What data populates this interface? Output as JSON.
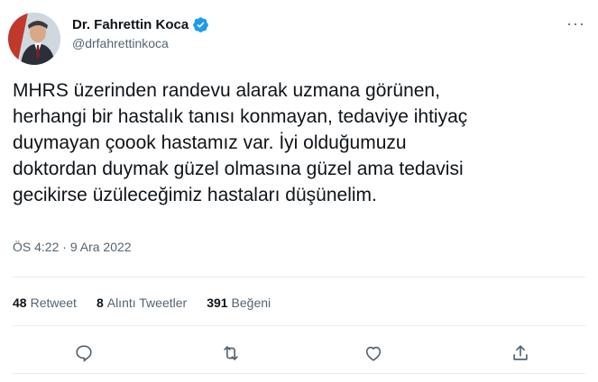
{
  "author": {
    "display_name": "Dr. Fahrettin Koca",
    "handle": "@drfahrettinkoca"
  },
  "tweet": {
    "text": "MHRS üzerinden randevu alarak uzmana görünen,\nherhangi bir hastalık tanısı konmayan, tedaviye ihtiyaç\nduymayan çoook hastamız var. İyi olduğumuzu\ndoktordan duymak güzel olmasına güzel ama tedavisi\ngecikirse üzüleceğimiz hastaları düşünelim.",
    "time": "ÖS 4:22",
    "separator": "·",
    "date": "9 Ara 2022"
  },
  "stats": {
    "retweets": {
      "count": "48",
      "label": "Retweet"
    },
    "quotes": {
      "count": "8",
      "label": "Alıntı Tweetler"
    },
    "likes": {
      "count": "391",
      "label": "Beğeni"
    }
  },
  "more_label": "···",
  "icons": {
    "verified": "verified-badge-icon",
    "reply": "reply-icon",
    "retweet": "retweet-icon",
    "like": "like-icon",
    "share": "share-icon"
  },
  "colors": {
    "verified": "#1d9bf0",
    "text": "#0f1419",
    "secondary": "#536471",
    "divider": "#e6ecf0"
  }
}
